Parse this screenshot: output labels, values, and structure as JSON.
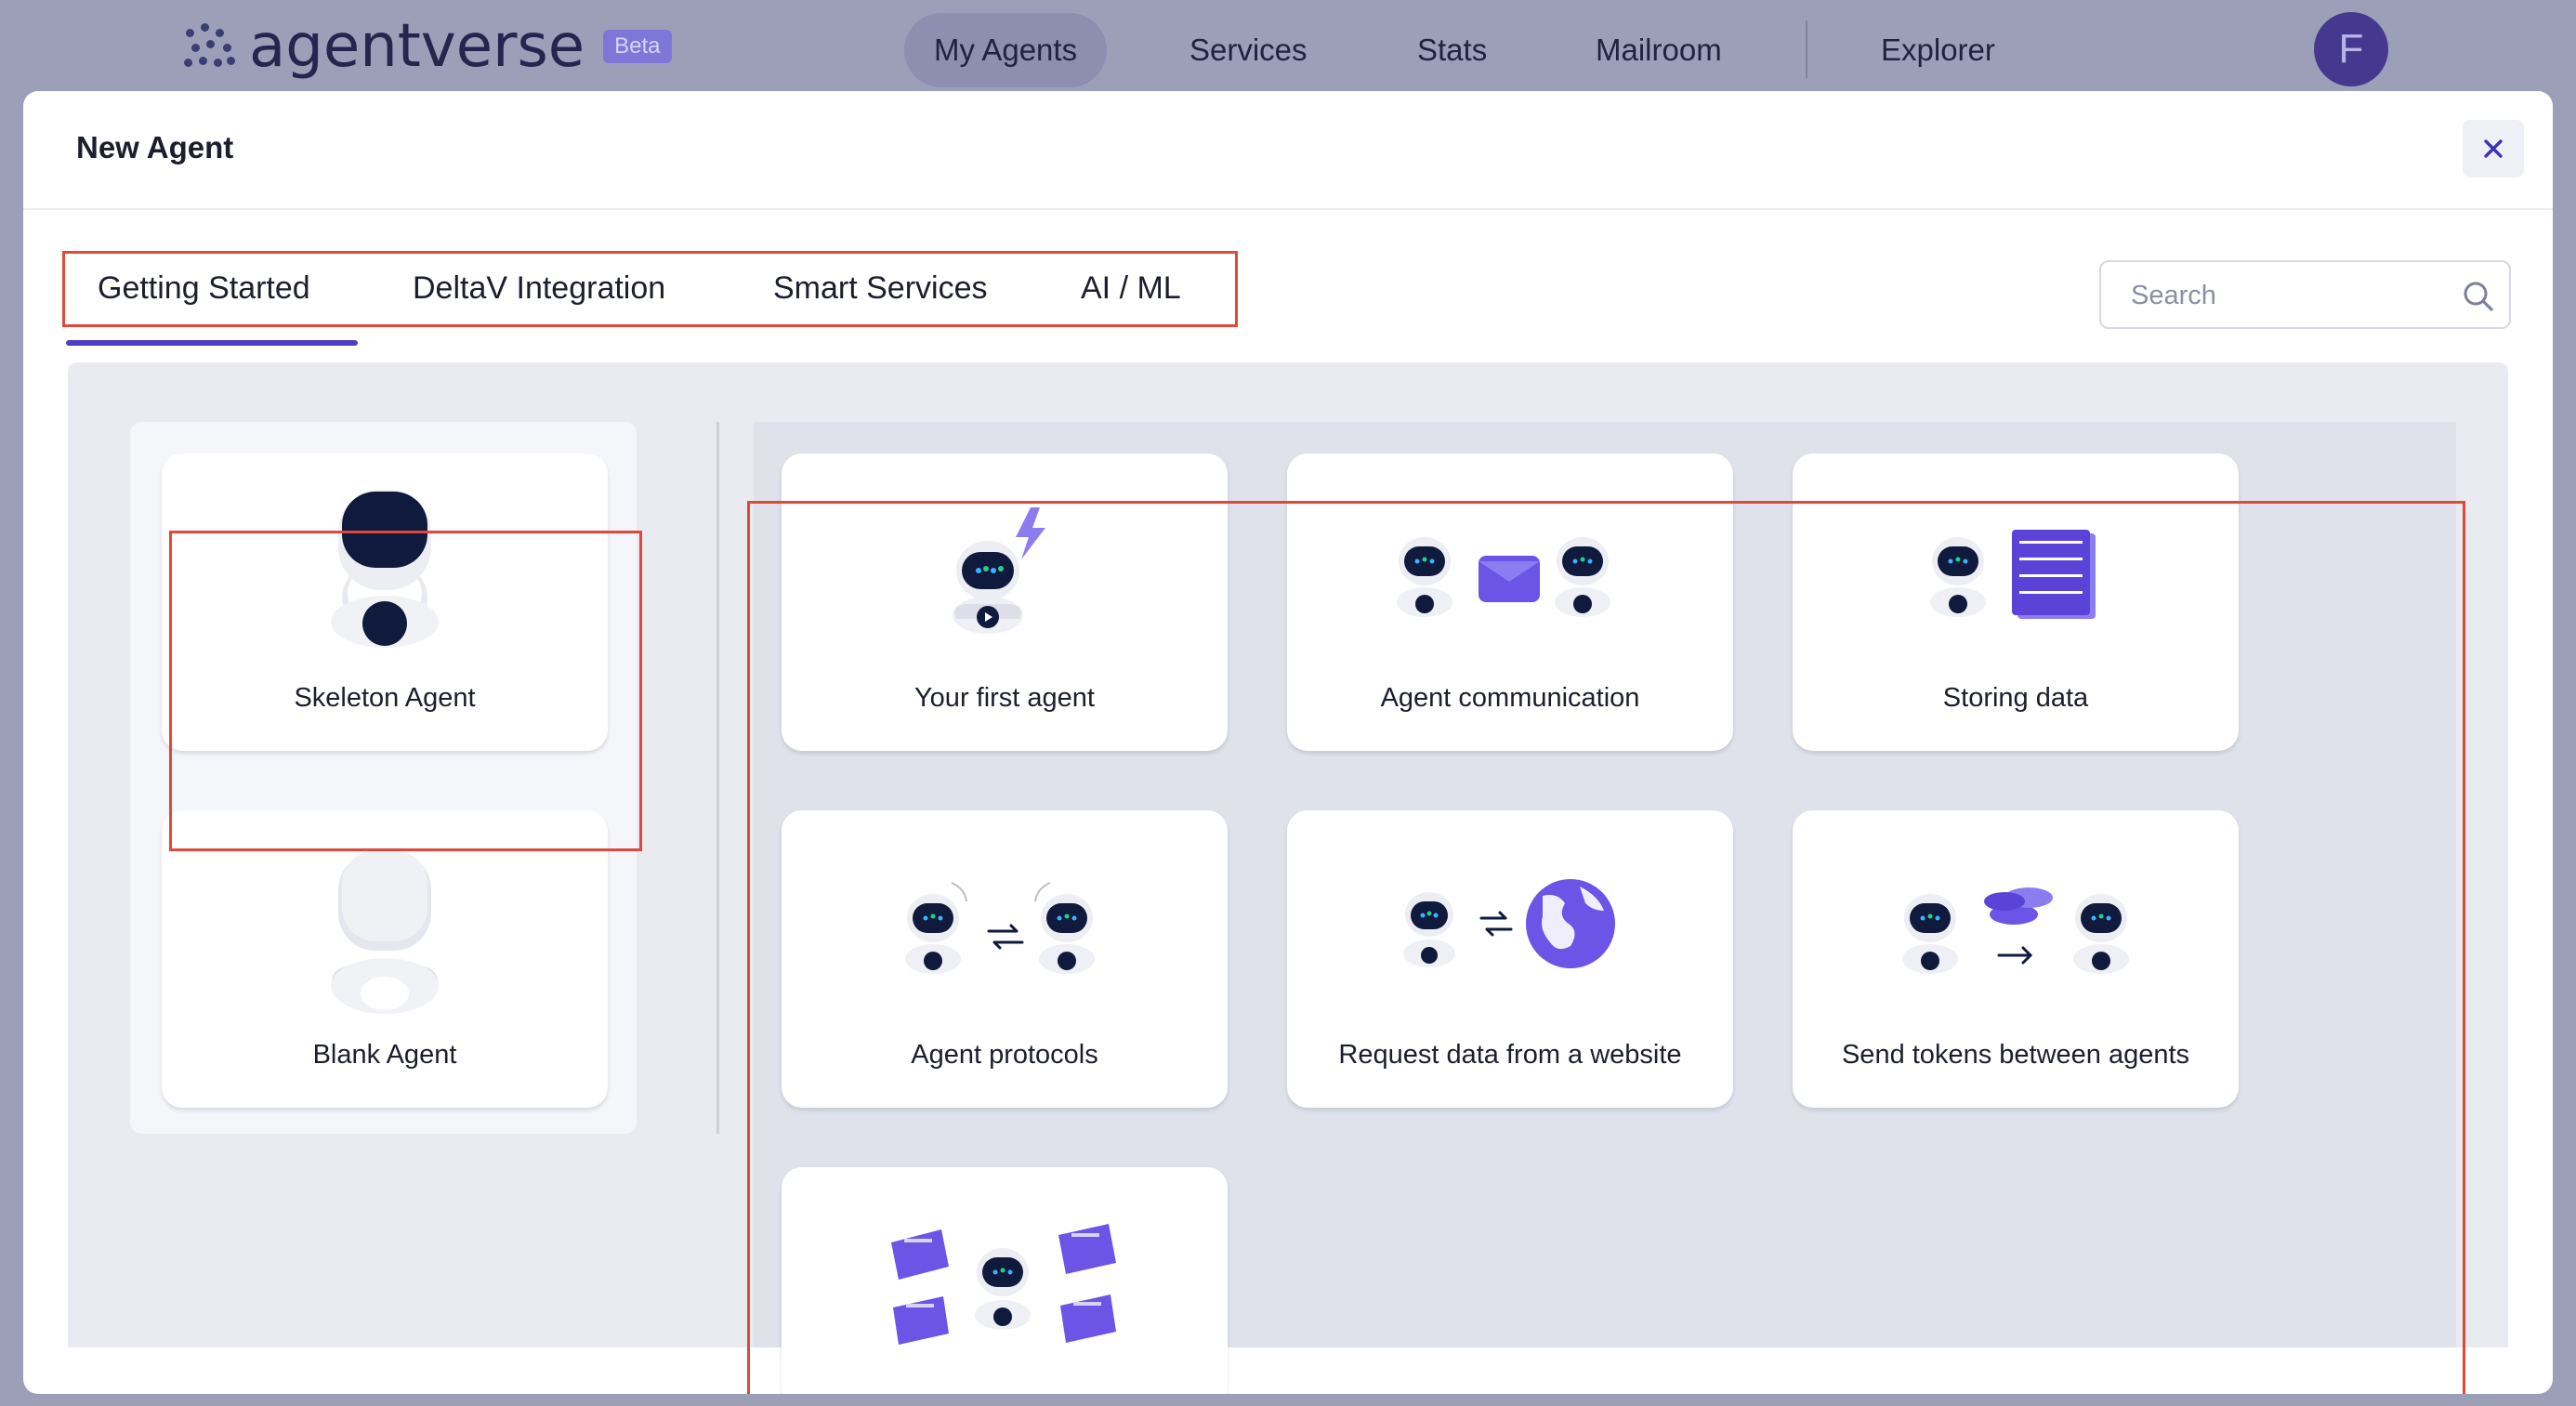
{
  "app": {
    "logo_text": "agentverse",
    "beta_badge": "Beta",
    "nav": [
      {
        "label": "My Agents",
        "active": true
      },
      {
        "label": "Services"
      },
      {
        "label": "Stats"
      },
      {
        "label": "Mailroom"
      },
      {
        "label": "Explorer"
      }
    ],
    "avatar_initial": "F"
  },
  "modal": {
    "title": "New Agent",
    "close_icon": "close-icon",
    "tabs": [
      {
        "label": "Getting Started",
        "active": true
      },
      {
        "label": "DeltaV Integration"
      },
      {
        "label": "Smart Services"
      },
      {
        "label": "AI / ML"
      }
    ],
    "search": {
      "placeholder": "Search",
      "value": ""
    },
    "templates_left": [
      {
        "label": "Skeleton Agent",
        "icon": "skeleton-robot-icon"
      },
      {
        "label": "Blank Agent",
        "icon": "blank-robot-icon"
      }
    ],
    "templates_right": [
      {
        "label": "Your first agent",
        "icon": "robot-lightning-icon"
      },
      {
        "label": "Agent communication",
        "icon": "robots-envelope-icon"
      },
      {
        "label": "Storing data",
        "icon": "robot-database-icon"
      },
      {
        "label": "Agent protocols",
        "icon": "robots-exchange-icon"
      },
      {
        "label": "Request data from a website",
        "icon": "robot-globe-icon"
      },
      {
        "label": "Send tokens between agents",
        "icon": "robots-coins-icon"
      },
      {
        "label": "",
        "icon": "robot-mailboxes-icon"
      }
    ]
  },
  "colors": {
    "accent": "#4b3fc4",
    "highlight_border": "#e2473a",
    "robot_dark": "#0f1a3d",
    "purple": "#6b54e6"
  }
}
